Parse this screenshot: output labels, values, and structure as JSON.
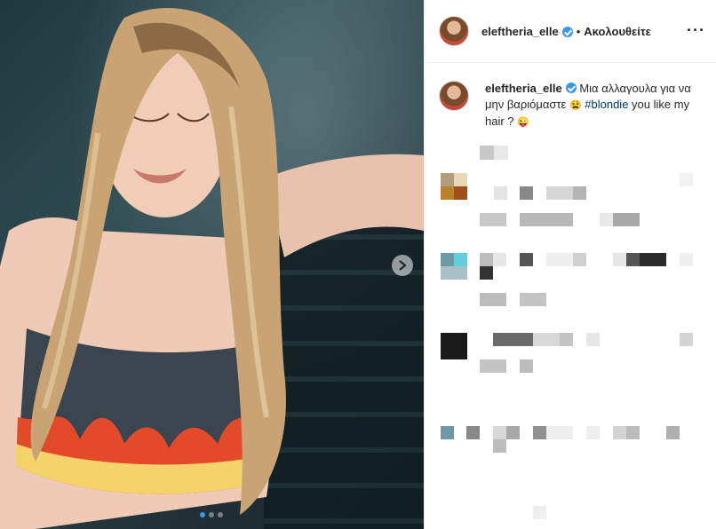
{
  "post": {
    "username": "eleftheria_elle",
    "separator": "•",
    "follow_label": "Ακολουθείτε",
    "more_icon": "ellipsis-icon",
    "caption": {
      "username": "eleftheria_elle",
      "text_before": "Μια αλλαγουλα για να μην βαριόμαστε",
      "emoji1": "😫",
      "hashtag": "#blondie",
      "text_after": "you like my hair ?",
      "emoji2": "😜"
    },
    "carousel": {
      "count": 3,
      "active": 0
    }
  },
  "colors": {
    "accent": "#3897f0",
    "hashtag": "#003569"
  }
}
